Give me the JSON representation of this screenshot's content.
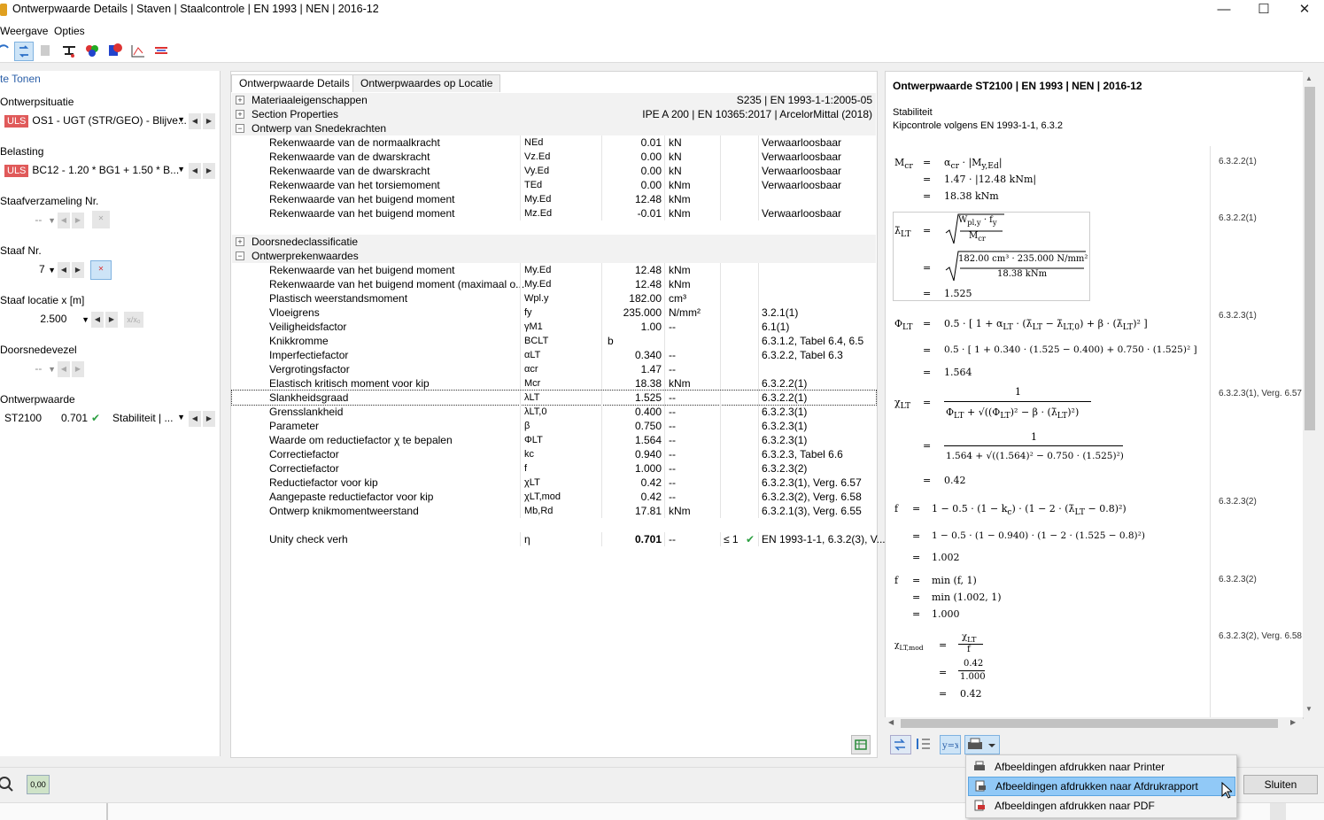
{
  "window": {
    "title": "Ontwerpwaarde Details | Staven | Staalcontrole | EN 1993 | NEN | 2016-12"
  },
  "menu": {
    "items": [
      "Weergave",
      "Opties"
    ]
  },
  "left": {
    "header": "te Tonen",
    "situatie_label": "Ontwerpsituatie",
    "situatie_badge": "ULS",
    "situatie_value": "OS1 - UGT (STR/GEO) - Blijve...",
    "belasting_label": "Belasting",
    "belasting_badge": "ULS",
    "belasting_value": "BC12 - 1.20 * BG1 + 1.50 * B...",
    "staafverz_label": "Staafverzameling Nr.",
    "staafverz_value": "--",
    "staaf_label": "Staaf Nr.",
    "staaf_value": "7",
    "locatie_label": "Staaf locatie x [m]",
    "locatie_value": "2.500",
    "doorsnede_label": "Doorsnedevezel",
    "doorsnede_value": "--",
    "ontwerp_label": "Ontwerpwaarde",
    "ontwerp_code": "ST2100",
    "ontwerp_value": "0.701",
    "ontwerp_type": "Stabiliteit | ..."
  },
  "tabs": [
    {
      "label": "Ontwerpwaarde Details"
    },
    {
      "label": "Ontwerpwaardes op Locatie"
    }
  ],
  "groups": {
    "materiaal": {
      "label": "Materiaaleigenschappen",
      "info": "S235 | EN 1993-1-1:2005-05"
    },
    "section": {
      "label": "Section Properties",
      "info": "IPE A 200 | EN 10365:2017 | ArcelorMittal (2018)"
    },
    "snedekrachten": {
      "label": "Ontwerp van Snedekrachten"
    },
    "doorsnede": {
      "label": "Doorsnedeclassificatie"
    },
    "rekenwaardes": {
      "label": "Ontwerprekenwaardes"
    }
  },
  "forces": [
    {
      "name": "Rekenwaarde van de normaalkracht",
      "sym": "NEd",
      "val": "0.01",
      "unit": "kN",
      "ref": "Verwaarloosbaar"
    },
    {
      "name": "Rekenwaarde van de dwarskracht",
      "sym": "Vz.Ed",
      "val": "0.00",
      "unit": "kN",
      "ref": "Verwaarloosbaar"
    },
    {
      "name": "Rekenwaarde van de dwarskracht",
      "sym": "Vy.Ed",
      "val": "0.00",
      "unit": "kN",
      "ref": "Verwaarloosbaar"
    },
    {
      "name": "Rekenwaarde van het torsiemoment",
      "sym": "TEd",
      "val": "0.00",
      "unit": "kNm",
      "ref": "Verwaarloosbaar"
    },
    {
      "name": "Rekenwaarde van het buigend moment",
      "sym": "My.Ed",
      "val": "12.48",
      "unit": "kNm",
      "ref": ""
    },
    {
      "name": "Rekenwaarde van het buigend moment",
      "sym": "Mz.Ed",
      "val": "-0.01",
      "unit": "kNm",
      "ref": "Verwaarloosbaar"
    }
  ],
  "values": [
    {
      "name": "Rekenwaarde van het buigend moment",
      "sym": "My.Ed",
      "val": "12.48",
      "unit": "kNm",
      "ref": ""
    },
    {
      "name": "Rekenwaarde van het buigend moment (maximaal o...",
      "sym": "My.Ed",
      "val": "12.48",
      "unit": "kNm",
      "ref": ""
    },
    {
      "name": "Plastisch weerstandsmoment",
      "sym": "Wpl.y",
      "val": "182.00",
      "unit": "cm³",
      "ref": ""
    },
    {
      "name": "Vloeigrens",
      "sym": "fy",
      "val": "235.000",
      "unit": "N/mm²",
      "ref": "3.2.1(1)"
    },
    {
      "name": "Veiligheidsfactor",
      "sym": "γM1",
      "val": "1.00",
      "unit": "--",
      "ref": "6.1(1)"
    },
    {
      "name": "Knikkromme",
      "sym": "BCLT",
      "val": "b",
      "unit": "",
      "ref": "6.3.1.2, Tabel 6.4, 6.5"
    },
    {
      "name": "Imperfectiefactor",
      "sym": "αLT",
      "val": "0.340",
      "unit": "--",
      "ref": "6.3.2.2, Tabel 6.3"
    },
    {
      "name": "Vergrotingsfactor",
      "sym": "αcr",
      "val": "1.47",
      "unit": "--",
      "ref": ""
    },
    {
      "name": "Elastisch kritisch moment voor kip",
      "sym": "Mcr",
      "val": "18.38",
      "unit": "kNm",
      "ref": "6.3.2.2(1)"
    },
    {
      "name": "Slankheidsgraad",
      "sym": "λLT",
      "val": "1.525",
      "unit": "--",
      "ref": "6.3.2.2(1)"
    },
    {
      "name": "Grensslankheid",
      "sym": "λLT,0",
      "val": "0.400",
      "unit": "--",
      "ref": "6.3.2.3(1)"
    },
    {
      "name": "Parameter",
      "sym": "β",
      "val": "0.750",
      "unit": "--",
      "ref": "6.3.2.3(1)"
    },
    {
      "name": "Waarde om reductiefactor χ te bepalen",
      "sym": "ΦLT",
      "val": "1.564",
      "unit": "--",
      "ref": "6.3.2.3(1)"
    },
    {
      "name": "Correctiefactor",
      "sym": "kc",
      "val": "0.940",
      "unit": "--",
      "ref": "6.3.2.3, Tabel 6.6"
    },
    {
      "name": "Correctiefactor",
      "sym": "f",
      "val": "1.000",
      "unit": "--",
      "ref": "6.3.2.3(2)"
    },
    {
      "name": "Reductiefactor voor kip",
      "sym": "χLT",
      "val": "0.42",
      "unit": "--",
      "ref": "6.3.2.3(1), Verg. 6.57"
    },
    {
      "name": "Aangepaste reductiefactor voor kip",
      "sym": "χLT,mod",
      "val": "0.42",
      "unit": "--",
      "ref": "6.3.2.3(2), Verg. 6.58"
    },
    {
      "name": "Ontwerp knikmomentweerstand",
      "sym": "Mb,Rd",
      "val": "17.81",
      "unit": "kNm",
      "ref": "6.3.2.1(3), Verg. 6.55"
    }
  ],
  "unity": {
    "name": "Unity check verh",
    "sym": "η",
    "val": "0.701",
    "unit": "--",
    "limit": "≤ 1",
    "ref": "EN 1993-1-1, 6.3.2(3), V..."
  },
  "formula": {
    "title": "Ontwerpwaarde ST2100 | EN 1993 | NEN | 2016-12",
    "section1": "Stabiliteit",
    "section2": "Kipcontrole volgens EN 1993-1-1, 6.3.2"
  },
  "popup": {
    "items": [
      "Afbeeldingen afdrukken naar Printer",
      "Afbeeldingen afdrukken naar Afdrukrapport",
      "Afbeeldingen afdrukken naar PDF"
    ]
  },
  "buttons": {
    "close": "Sluiten"
  },
  "colors": {
    "uls": "#e05a5a",
    "highlight": "#91c9f7",
    "check": "#2ea043"
  }
}
